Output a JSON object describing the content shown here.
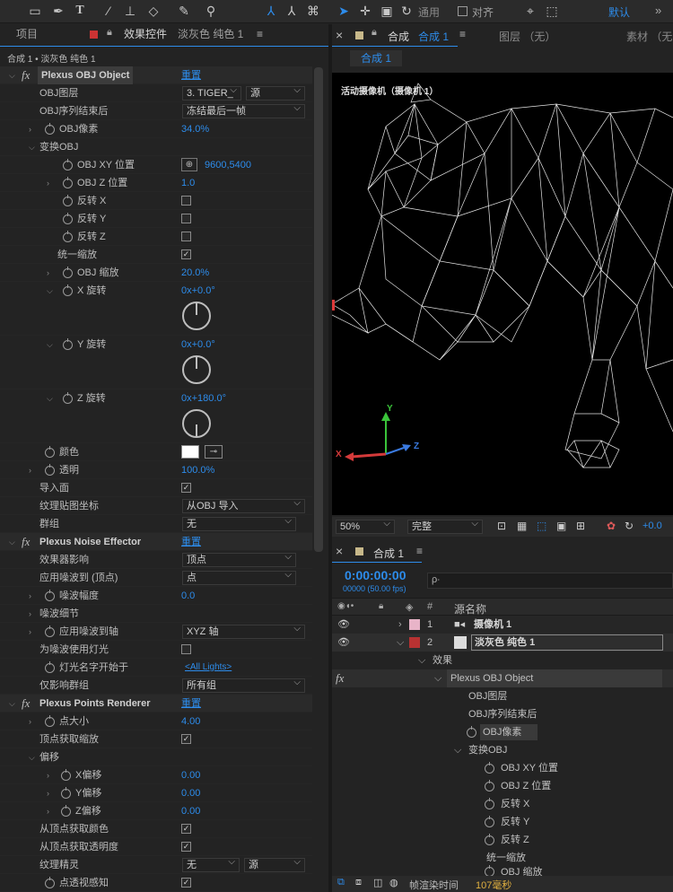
{
  "toolbar": {
    "snap_label": "对齐",
    "default_label": "默认",
    "menu_icon": "»",
    "general_label": "通用"
  },
  "left_panel": {
    "tab_project": "项目",
    "tab_effects": "效果控件",
    "tab_layer": "淡灰色 纯色 1",
    "breadcrumb": "合成 1 • 淡灰色 纯色 1"
  },
  "effects": {
    "obj": {
      "name": "Plexus OBJ Object",
      "reset": "重置",
      "obj_layer_label": "OBJ图层",
      "obj_layer_value": "3. TIGER_",
      "obj_layer_src": "源",
      "seq_end_label": "OBJ序列结束后",
      "seq_end_value": "冻结最后一帧",
      "obj_pixels_label": "OBJ像素",
      "obj_pixels_value": "34.0%",
      "transform_label": "变换OBJ",
      "xy_label": "OBJ XY 位置",
      "xy_value": "9600,5400",
      "z_label": "OBJ Z 位置",
      "z_value": "1.0",
      "flipx_label": "反转 X",
      "flipy_label": "反转 Y",
      "flipz_label": "反转 Z",
      "uniform_label": "统一缩放",
      "scale_label": "OBJ 缩放",
      "scale_value": "20.0%",
      "xrot_label": "X 旋转",
      "xrot_value": "0x+0.0°",
      "yrot_label": "Y 旋转",
      "yrot_value": "0x+0.0°",
      "zrot_label": "Z 旋转",
      "zrot_value": "0x+180.0°",
      "color_label": "颜色",
      "opacity_label": "透明",
      "opacity_value": "100.0%",
      "import_faces_label": "导入面",
      "uv_label": "纹理贴图坐标",
      "uv_value": "从OBJ 导入",
      "group_label": "群组",
      "group_value": "无"
    },
    "noise": {
      "name": "Plexus Noise Effector",
      "reset": "重置",
      "influence_label": "效果器影响",
      "influence_value": "顶点",
      "apply_label": "应用噪波到 (顶点)",
      "apply_value": "点",
      "amp_label": "噪波幅度",
      "amp_value": "0.0",
      "detail_label": "噪波细节",
      "axis_label": "应用噪波到轴",
      "axis_value": "XYZ 轴",
      "use_lights_label": "为噪波使用灯光",
      "light_name_label": "灯光名字开始于",
      "light_name_value": "<All Lights>",
      "only_group_label": "仅影响群组",
      "only_group_value": "所有组"
    },
    "points": {
      "name": "Plexus Points Renderer",
      "reset": "重置",
      "size_label": "点大小",
      "size_value": "4.00",
      "vertex_scale_label": "顶点获取缩放",
      "offset_label": "偏移",
      "xoff_label": "X偏移",
      "xoff_value": "0.00",
      "yoff_label": "Y偏移",
      "yoff_value": "0.00",
      "zoff_label": "Z偏移",
      "zoff_value": "0.00",
      "vertex_color_label": "从顶点获取颜色",
      "vertex_opacity_label": "从顶点获取透明度",
      "sprite_label": "纹理精灵",
      "sprite_value": "无",
      "sprite_src": "源",
      "persp_label": "点透视感知"
    }
  },
  "viewer": {
    "tab_comp": "合成",
    "tab_comp_name": "合成 1",
    "tab_layer": "图层 （无）",
    "tab_footage": "素材 （无",
    "subtab": "合成 1",
    "camera_label": "活动摄像机（摄像机 1）",
    "zoom": "50%",
    "quality": "完整",
    "exposure": "+0.0",
    "axis_x": "X",
    "axis_y": "Y",
    "axis_z": "Z"
  },
  "timeline": {
    "tab": "合成 1",
    "timecode": "0:00:00:00",
    "frame_info": "00000 (50.00 fps)",
    "search_placeholder": "ρ∙",
    "col_hash": "#",
    "col_source": "源名称",
    "layers": [
      {
        "num": "1",
        "name": "摄像机 1"
      },
      {
        "num": "2",
        "name": "淡灰色 纯色 1"
      }
    ],
    "effects_label": "效果",
    "fx_label": "fx",
    "tree": {
      "plexus": "Plexus OBJ Object",
      "obj_layer": "OBJ图层",
      "seq_end": "OBJ序列结束后",
      "obj_pixels": "OBJ像素",
      "transform": "变换OBJ",
      "xy": "OBJ XY 位置",
      "z": "OBJ Z 位置",
      "fx": "反转 X",
      "fy": "反转 Y",
      "fz": "反转 Z",
      "uniform": "统一缩放",
      "scale": "OBJ 缩放"
    },
    "render_label": "帧渲染时间",
    "render_value": "107毫秒"
  },
  "colors": {
    "accent": "#2d8ceb",
    "layer1_label": "#e8b4c8",
    "layer2_label": "#b83232"
  }
}
